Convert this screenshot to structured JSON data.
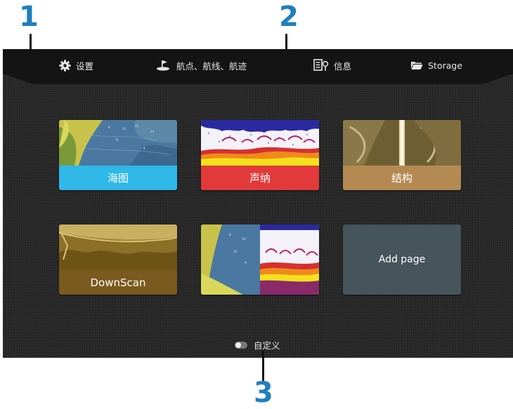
{
  "callouts": [
    "1",
    "2",
    "3"
  ],
  "topbar": {
    "items": [
      {
        "label": "设置",
        "icon": "gear-icon"
      },
      {
        "label": "航点、航线、航迹",
        "icon": "waypoint-icon"
      },
      {
        "label": "信息",
        "icon": "info-panel-icon"
      },
      {
        "label": "Storage",
        "icon": "folder-icon"
      }
    ]
  },
  "tiles": [
    {
      "label": "海图",
      "color": "#2fb8e8"
    },
    {
      "label": "声纳",
      "color": "#e23a3a"
    },
    {
      "label": "结构",
      "color": "#b58a52"
    },
    {
      "label": "DownScan",
      "color": "#7a5a1e"
    },
    {
      "label": "",
      "color": ""
    },
    {
      "label": "Add page",
      "color": "#46545c"
    }
  ],
  "customize": {
    "label": "自定义"
  }
}
